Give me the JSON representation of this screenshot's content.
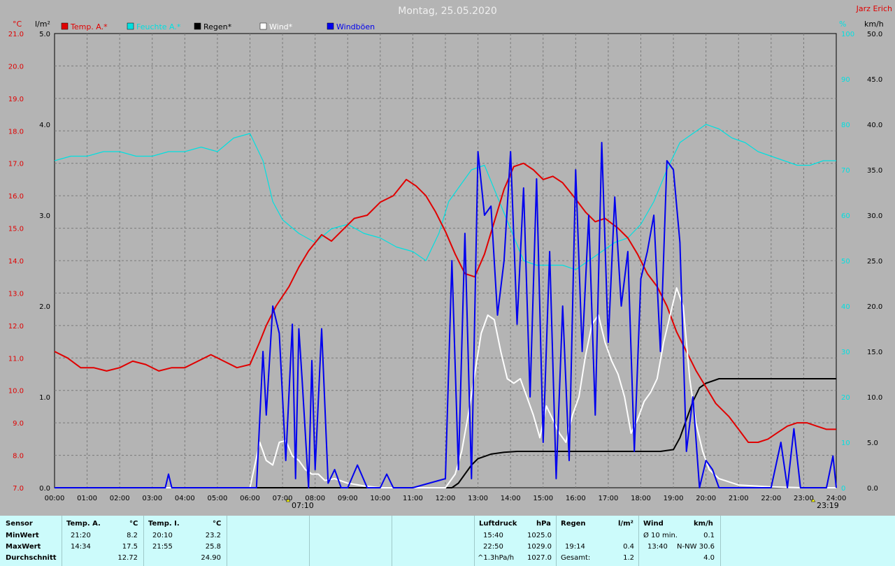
{
  "header": {
    "title": "Montag, 25.05.2020",
    "author": "Jarz Erich",
    "unit_left_temp": "°C",
    "unit_left_rain": "l/m²",
    "unit_right_pct": "%",
    "unit_right_wind": "km/h"
  },
  "legend": [
    {
      "label": "Temp. A.*",
      "color": "#e00000"
    },
    {
      "label": "Feuchte A.*",
      "color": "#00e0e0"
    },
    {
      "label": "Regen*",
      "color": "#000000"
    },
    {
      "label": "Wind*",
      "color": "#ffffff"
    },
    {
      "label": "Windböen",
      "color": "#0000ee"
    }
  ],
  "markers": {
    "sunrise": "07:10",
    "sunset": "23:19"
  },
  "chart_data": {
    "type": "line",
    "title": "Montag, 25.05.2020",
    "xlabel": "",
    "x_ticks": [
      "00:00",
      "01:00",
      "02:00",
      "03:00",
      "04:00",
      "05:00",
      "06:00",
      "07:00",
      "08:00",
      "09:00",
      "10:00",
      "11:00",
      "12:00",
      "13:00",
      "14:00",
      "15:00",
      "16:00",
      "17:00",
      "18:00",
      "19:00",
      "20:00",
      "21:00",
      "22:00",
      "23:00",
      "24:00"
    ],
    "axes": {
      "temp": {
        "label": "°C",
        "range": [
          7.0,
          21.0
        ],
        "ticks": [
          "7.0",
          "8.0",
          "9.0",
          "10.0",
          "11.0",
          "12.0",
          "13.0",
          "14.0",
          "15.0",
          "16.0",
          "17.0",
          "18.0",
          "19.0",
          "20.0",
          "21.0"
        ]
      },
      "rain": {
        "label": "l/m²",
        "range": [
          0.0,
          5.0
        ],
        "ticks": [
          "0.0",
          "1.0",
          "2.0",
          "3.0",
          "4.0",
          "5.0"
        ]
      },
      "humidity": {
        "label": "%",
        "range": [
          0,
          100
        ],
        "ticks": [
          "0",
          "10",
          "20",
          "30",
          "40",
          "50",
          "60",
          "70",
          "80",
          "90",
          "100"
        ]
      },
      "wind": {
        "label": "km/h",
        "range": [
          0.0,
          50.0
        ],
        "ticks": [
          "0.0",
          "5.0",
          "10.0",
          "15.0",
          "20.0",
          "25.0",
          "30.0",
          "35.0",
          "40.0",
          "45.0",
          "50.0"
        ]
      }
    },
    "grid": true,
    "series": [
      {
        "name": "Temp. A.*",
        "axis": "temp",
        "color": "#e00000",
        "x": [
          0,
          0.4,
          0.8,
          1.2,
          1.6,
          2.0,
          2.4,
          2.8,
          3.2,
          3.6,
          4.0,
          4.4,
          4.8,
          5.2,
          5.6,
          6.0,
          6.3,
          6.5,
          6.8,
          7.2,
          7.5,
          7.8,
          8.2,
          8.5,
          8.8,
          9.2,
          9.6,
          10.0,
          10.4,
          10.8,
          11.1,
          11.4,
          11.7,
          12.0,
          12.3,
          12.6,
          12.9,
          13.2,
          13.5,
          13.8,
          14.1,
          14.4,
          14.7,
          15.0,
          15.3,
          15.6,
          16.0,
          16.3,
          16.6,
          16.9,
          17.3,
          17.6,
          17.9,
          18.2,
          18.5,
          18.8,
          19.1,
          19.4,
          19.7,
          20.0,
          20.3,
          20.7,
          21.0,
          21.3,
          21.6,
          21.9,
          22.2,
          22.5,
          22.8,
          23.1,
          23.4,
          23.7,
          24.0
        ],
        "y": [
          11.2,
          11.0,
          10.7,
          10.7,
          10.6,
          10.7,
          10.9,
          10.8,
          10.6,
          10.7,
          10.7,
          10.9,
          11.1,
          10.9,
          10.7,
          10.8,
          11.5,
          12.0,
          12.6,
          13.2,
          13.8,
          14.3,
          14.8,
          14.6,
          14.9,
          15.3,
          15.4,
          15.8,
          16.0,
          16.5,
          16.3,
          16.0,
          15.5,
          14.9,
          14.2,
          13.6,
          13.5,
          14.2,
          15.2,
          16.2,
          16.9,
          17.0,
          16.8,
          16.5,
          16.6,
          16.4,
          15.9,
          15.5,
          15.2,
          15.3,
          15.0,
          14.7,
          14.2,
          13.6,
          13.2,
          12.6,
          11.8,
          11.2,
          10.6,
          10.1,
          9.6,
          9.2,
          8.8,
          8.4,
          8.4,
          8.5,
          8.7,
          8.9,
          9.0,
          9.0,
          8.9,
          8.8,
          8.8
        ]
      },
      {
        "name": "Feuchte A.*",
        "axis": "humidity",
        "color": "#00e0e0",
        "x": [
          0,
          0.5,
          1.0,
          1.5,
          2.0,
          2.5,
          3.0,
          3.5,
          4.0,
          4.5,
          5.0,
          5.5,
          6.0,
          6.4,
          6.7,
          7.0,
          7.5,
          8.0,
          8.5,
          9.0,
          9.5,
          10.0,
          10.5,
          11.0,
          11.4,
          11.8,
          12.1,
          12.4,
          12.8,
          13.2,
          13.6,
          14.0,
          14.4,
          14.8,
          15.2,
          15.6,
          16.0,
          16.4,
          16.8,
          17.2,
          17.6,
          18.0,
          18.4,
          18.8,
          19.2,
          19.6,
          20.0,
          20.4,
          20.8,
          21.2,
          21.6,
          22.0,
          22.4,
          22.8,
          23.2,
          23.6,
          24.0
        ],
        "y": [
          72,
          73,
          73,
          74,
          74,
          73,
          73,
          74,
          74,
          75,
          74,
          77,
          78,
          72,
          63,
          59,
          56,
          54,
          57,
          58,
          56,
          55,
          53,
          52,
          50,
          56,
          63,
          66,
          70,
          71,
          64,
          57,
          50,
          49,
          49,
          49,
          48,
          50,
          52,
          54,
          55,
          58,
          63,
          70,
          76,
          78,
          80,
          79,
          77,
          76,
          74,
          73,
          72,
          71,
          71,
          72,
          72
        ]
      },
      {
        "name": "Regen*",
        "axis": "rain",
        "color": "#000000",
        "x": [
          0,
          12.2,
          12.4,
          12.6,
          12.8,
          13.0,
          13.4,
          13.8,
          14.2,
          14.6,
          15.0,
          16.0,
          17.0,
          18.0,
          18.6,
          19.0,
          19.2,
          19.4,
          19.6,
          19.8,
          20.0,
          20.4,
          20.8,
          21.2,
          22.0,
          23.0,
          24.0
        ],
        "y": [
          0,
          0,
          0.05,
          0.15,
          0.25,
          0.32,
          0.37,
          0.39,
          0.4,
          0.4,
          0.4,
          0.4,
          0.4,
          0.4,
          0.4,
          0.42,
          0.55,
          0.75,
          0.95,
          1.1,
          1.15,
          1.2,
          1.2,
          1.2,
          1.2,
          1.2,
          1.2
        ]
      },
      {
        "name": "Wind*",
        "axis": "wind",
        "color": "#ffffff",
        "x": [
          0,
          6.0,
          6.3,
          6.5,
          6.7,
          6.9,
          7.1,
          7.3,
          7.5,
          7.7,
          7.9,
          8.1,
          8.3,
          8.6,
          9.0,
          9.5,
          10.0,
          11.0,
          12.0,
          12.3,
          12.5,
          12.7,
          12.9,
          13.1,
          13.3,
          13.5,
          13.7,
          13.9,
          14.1,
          14.3,
          14.5,
          14.7,
          14.9,
          15.1,
          15.3,
          15.5,
          15.7,
          15.9,
          16.1,
          16.3,
          16.5,
          16.7,
          16.9,
          17.1,
          17.3,
          17.5,
          17.7,
          17.9,
          18.1,
          18.3,
          18.5,
          18.7,
          18.9,
          19.1,
          19.3,
          19.5,
          19.7,
          19.9,
          20.1,
          20.4,
          21.0,
          22.0,
          23.0,
          24.0
        ],
        "y": [
          0,
          0,
          5.0,
          3.0,
          2.5,
          5.0,
          5.2,
          3.5,
          3.0,
          2.0,
          1.5,
          1.5,
          0.8,
          1.0,
          0.5,
          0.2,
          0,
          0,
          0,
          1.5,
          4.0,
          8.0,
          12.5,
          17.0,
          19.0,
          18.5,
          15.0,
          12.0,
          11.5,
          12.0,
          10.0,
          8.0,
          5.5,
          9.0,
          7.5,
          6.0,
          5.0,
          8.0,
          10.0,
          14.5,
          18.0,
          19.0,
          16.0,
          14.0,
          12.5,
          10.0,
          6.0,
          7.5,
          9.5,
          10.5,
          12.0,
          16.0,
          19.0,
          22.0,
          20.0,
          12.0,
          7.0,
          4.0,
          2.0,
          1.0,
          0.3,
          0.1,
          0,
          0
        ]
      },
      {
        "name": "Windböen",
        "axis": "wind",
        "color": "#0000ee",
        "x": [
          0,
          3.4,
          3.5,
          3.6,
          6.2,
          6.4,
          6.5,
          6.7,
          6.9,
          7.1,
          7.3,
          7.4,
          7.5,
          7.6,
          7.8,
          7.9,
          8.0,
          8.2,
          8.4,
          8.6,
          8.8,
          9.0,
          9.3,
          9.6,
          10.0,
          10.2,
          10.4,
          10.6,
          11.0,
          12.0,
          12.2,
          12.4,
          12.6,
          12.8,
          13.0,
          13.2,
          13.4,
          13.6,
          13.8,
          14.0,
          14.2,
          14.4,
          14.6,
          14.8,
          15.0,
          15.2,
          15.4,
          15.6,
          15.8,
          16.0,
          16.2,
          16.4,
          16.6,
          16.8,
          17.0,
          17.2,
          17.4,
          17.6,
          17.8,
          18.0,
          18.2,
          18.4,
          18.6,
          18.8,
          19.0,
          19.2,
          19.4,
          19.6,
          19.8,
          20.0,
          20.2,
          20.4,
          21.0,
          22.0,
          22.3,
          22.5,
          22.7,
          22.9,
          23.1,
          23.3,
          23.5,
          23.7,
          23.9,
          24.0
        ],
        "y": [
          0,
          0,
          1.5,
          0,
          0,
          15.0,
          8.0,
          20.0,
          17.0,
          3.0,
          18.0,
          1.0,
          17.5,
          12.0,
          0,
          14.0,
          2.0,
          17.5,
          0.5,
          2.0,
          0,
          0,
          2.5,
          0,
          0,
          1.5,
          0,
          0,
          0,
          1.0,
          25.0,
          2.0,
          28.0,
          1.0,
          37.0,
          30.0,
          31.0,
          19.0,
          25.0,
          37.0,
          18.0,
          33.0,
          10.0,
          34.0,
          5.0,
          26.0,
          1.0,
          20.0,
          3.0,
          35.0,
          15.0,
          30.0,
          8.0,
          38.0,
          16.0,
          32.0,
          20.0,
          26.0,
          4.0,
          23.0,
          26.0,
          30.0,
          15.0,
          36.0,
          35.0,
          27.0,
          4.0,
          10.0,
          0,
          3.0,
          2.0,
          0,
          0,
          0,
          5.0,
          0,
          6.5,
          0,
          0,
          0,
          0,
          0,
          3.5,
          0
        ]
      }
    ]
  },
  "stats": {
    "sensor_label": "Sensor",
    "row_labels": [
      "MinWert",
      "MaxWert",
      "Durchschnitt"
    ],
    "temp_a": {
      "title": "Temp. A.",
      "unit": "°C",
      "rows": [
        [
          "21:20",
          "8.2"
        ],
        [
          "14:34",
          "17.5"
        ],
        [
          "",
          "12.72"
        ]
      ]
    },
    "temp_i": {
      "title": "Temp. I.",
      "unit": "°C",
      "rows": [
        [
          "20:10",
          "23.2"
        ],
        [
          "21:55",
          "25.8"
        ],
        [
          "",
          "24.90"
        ]
      ]
    },
    "luftdruck": {
      "title": "Luftdruck",
      "unit": "hPa",
      "rows": [
        [
          "15:40",
          "1025.0"
        ],
        [
          "22:50",
          "1029.0"
        ],
        [
          "^1.3hPa/h",
          "1027.0"
        ]
      ]
    },
    "regen": {
      "title": "Regen",
      "unit": "l/m²",
      "rows": [
        [
          "",
          ""
        ],
        [
          "19:14",
          "0.4"
        ],
        [
          "Gesamt:",
          "1.2"
        ]
      ]
    },
    "wind": {
      "title": "Wind",
      "unit": "km/h",
      "rows": [
        [
          "Ø 10 min.",
          "",
          "0.1"
        ],
        [
          "13:40",
          "N-NW",
          "30.6"
        ],
        [
          "",
          "",
          "4.0"
        ]
      ]
    }
  }
}
